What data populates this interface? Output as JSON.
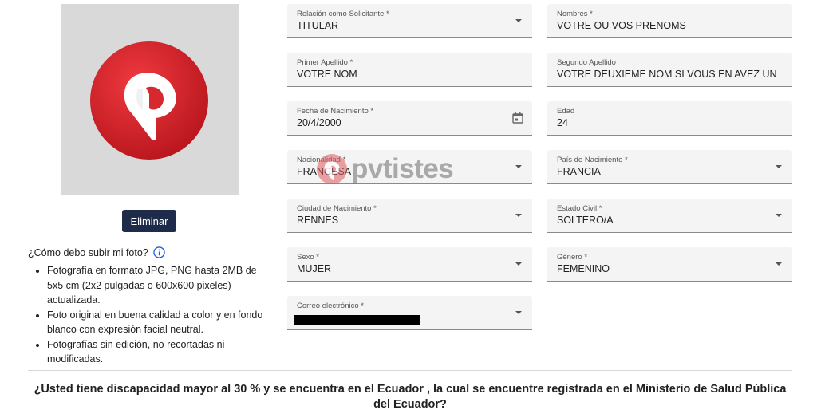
{
  "photo": {
    "delete_label": "Eliminar"
  },
  "help": {
    "question": "¿Cómo debo subir mi foto?",
    "bullets": [
      "Fotografía en formato JPG, PNG hasta 2MB de 5x5 cm (2x2 pulgadas o 600x600 pixeles) actualizada.",
      "Foto original en buena calidad a color y en fondo blanco con expresión facial neutral.",
      "Fotografías sin edición, no recortadas ni modificadas."
    ]
  },
  "form": {
    "relacion": {
      "label": "Relación como Solicitante *",
      "value": "TITULAR"
    },
    "nombres": {
      "label": "Nombres *",
      "value": "VOTRE OU VOS PRENOMS"
    },
    "primer_apellido": {
      "label": "Primer Apellido *",
      "value": "VOTRE NOM"
    },
    "segundo_apellido": {
      "label": "Segundo Apellido",
      "value": "VOTRE DEUXIEME NOM SI VOUS EN AVEZ UN"
    },
    "fecha_nacimiento": {
      "label": "Fecha de Nacimiento *",
      "value": "20/4/2000"
    },
    "edad": {
      "label": "Edad",
      "value": "24"
    },
    "nacionalidad": {
      "label": "Nacionalidad *",
      "value": "FRANCESA"
    },
    "pais_nacimiento": {
      "label": "País de Nacimiento *",
      "value": "FRANCIA"
    },
    "ciudad_nacimiento": {
      "label": "Ciudad de Nacimiento *",
      "value": "RENNES"
    },
    "estado_civil": {
      "label": "Estado Civil *",
      "value": "SOLTERO/A"
    },
    "sexo": {
      "label": "Sexo *",
      "value": "MUJER"
    },
    "genero": {
      "label": "Género *",
      "value": "FEMENINO"
    },
    "correo": {
      "label": "Correo electrónico *",
      "value": ""
    }
  },
  "watermark": {
    "text": "pvtistes"
  },
  "disability_question": "¿Usted tiene discapacidad mayor al 30 % y se encuentra en el Ecuador , la cual se encuentre registrada en el Ministerio de Salud Pública del Ecuador?",
  "colors": {
    "primary_button": "#1f2b4a",
    "logo_red": "#d7282f",
    "field_bg": "#f4f4f4"
  }
}
